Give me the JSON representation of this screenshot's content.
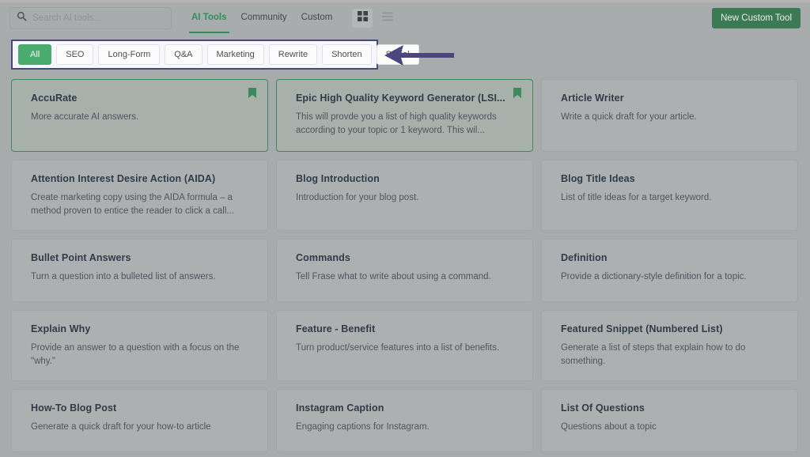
{
  "header": {
    "search": {
      "placeholder": "Search AI tools...",
      "value": "",
      "icon": "search-icon"
    },
    "tabs": [
      {
        "label": "AI Tools",
        "active": true
      },
      {
        "label": "Community",
        "active": false
      },
      {
        "label": "Custom",
        "active": false
      }
    ],
    "view_toggles": [
      {
        "name": "grid-view",
        "icon": "grid-icon",
        "selected": true
      },
      {
        "name": "list-view",
        "icon": "list-icon",
        "selected": false
      }
    ],
    "new_tool_button": "New Custom Tool"
  },
  "filters": {
    "highlight_color": "#4a477e",
    "active_color": "#49ab6d",
    "pills": [
      {
        "label": "All",
        "active": true
      },
      {
        "label": "SEO",
        "active": false
      },
      {
        "label": "Long-Form",
        "active": false
      },
      {
        "label": "Q&A",
        "active": false
      },
      {
        "label": "Marketing",
        "active": false
      },
      {
        "label": "Rewrite",
        "active": false
      },
      {
        "label": "Shorten",
        "active": false
      },
      {
        "label": "Social",
        "active": false
      }
    ],
    "annotation": {
      "type": "arrow",
      "direction": "left",
      "color": "#4a477e"
    }
  },
  "cards": [
    {
      "title": "AccuRate",
      "desc": "More accurate AI answers.",
      "saved": true,
      "row": "r1"
    },
    {
      "title": "Epic High Quality Keyword Generator (LSI...",
      "desc": "This will provde you a list of high quality keywords according to your topic or 1 keyword. This wil...",
      "saved": true,
      "row": "r1"
    },
    {
      "title": "Article Writer",
      "desc": "Write a quick draft for your article.",
      "saved": false,
      "row": "r1"
    },
    {
      "title": "Attention Interest Desire Action (AIDA)",
      "desc": "Create marketing copy using the AIDA formula – a method proven to entice the reader to click a call...",
      "saved": false,
      "row": "r2"
    },
    {
      "title": "Blog Introduction",
      "desc": "Introduction for your blog post.",
      "saved": false,
      "row": "r2"
    },
    {
      "title": "Blog Title Ideas",
      "desc": "List of title ideas for a target keyword.",
      "saved": false,
      "row": "r2"
    },
    {
      "title": "Bullet Point Answers",
      "desc": "Turn a question into a bulleted list of answers.",
      "saved": false,
      "row": "r3"
    },
    {
      "title": "Commands",
      "desc": "Tell Frase what to write about using a command.",
      "saved": false,
      "row": "r3"
    },
    {
      "title": "Definition",
      "desc": "Provide a dictionary-style definition for a topic.",
      "saved": false,
      "row": "r3"
    },
    {
      "title": "Explain Why",
      "desc": "Provide an answer to a question with a focus on the \"why.\"",
      "saved": false,
      "row": "r4"
    },
    {
      "title": "Feature - Benefit",
      "desc": "Turn product/service features into a list of benefits.",
      "saved": false,
      "row": "r4"
    },
    {
      "title": "Featured Snippet (Numbered List)",
      "desc": "Generate a list of steps that explain how to do something.",
      "saved": false,
      "row": "r4"
    },
    {
      "title": "How-To Blog Post",
      "desc": "Generate a quick draft for your how-to article",
      "saved": false,
      "row": "r5"
    },
    {
      "title": "Instagram Caption",
      "desc": "Engaging captions for Instagram.",
      "saved": false,
      "row": "r5"
    },
    {
      "title": "List Of Questions",
      "desc": "Questions about a topic",
      "saved": false,
      "row": "r5"
    }
  ]
}
